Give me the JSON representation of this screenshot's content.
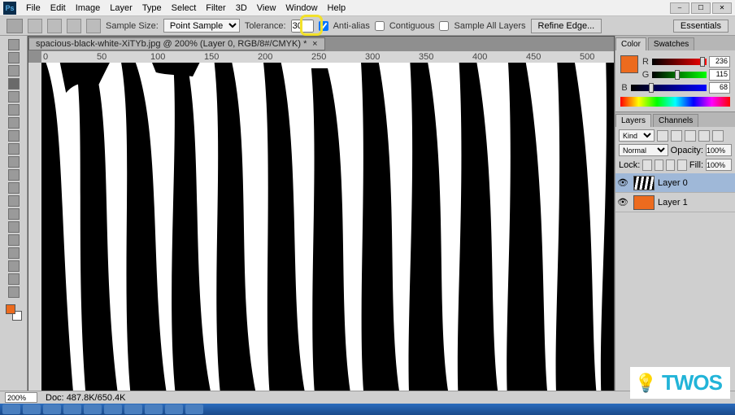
{
  "menu": {
    "items": [
      "File",
      "Edit",
      "Image",
      "Layer",
      "Type",
      "Select",
      "Filter",
      "3D",
      "View",
      "Window",
      "Help"
    ]
  },
  "options_bar": {
    "sample_size_label": "Sample Size:",
    "sample_size_value": "Point Sample",
    "tolerance_label": "Tolerance:",
    "tolerance_value": "30",
    "antialias_label": "Anti-alias",
    "antialias_checked": true,
    "contiguous_label": "Contiguous",
    "contiguous_checked": false,
    "sample_all_label": "Sample All Layers",
    "sample_all_checked": false,
    "refine_edge_label": "Refine Edge...",
    "workspace": "Essentials"
  },
  "document": {
    "tab_title": "spacious-black-white-XiTYb.jpg @ 200% (Layer 0, RGB/8#/CMYK) *",
    "ruler_marks": [
      "0",
      "50",
      "100",
      "150",
      "200",
      "250",
      "300",
      "350",
      "400",
      "450",
      "500"
    ]
  },
  "color_panel": {
    "tab1": "Color",
    "tab2": "Swatches",
    "r_label": "R",
    "g_label": "G",
    "b_label": "B",
    "r_value": "236",
    "g_value": "115",
    "b_value": "68",
    "fg_color": "#ec6b1e"
  },
  "layers_panel": {
    "tab1": "Layers",
    "tab2": "Channels",
    "filter_kind_label": "Kind",
    "blend_mode": "Normal",
    "opacity_label": "Opacity:",
    "opacity_value": "100%",
    "lock_label": "Lock:",
    "fill_label": "Fill:",
    "fill_value": "100%",
    "layers": [
      {
        "name": "Layer 0",
        "thumb": "zebra",
        "active": true
      },
      {
        "name": "Layer 1",
        "thumb": "orange",
        "active": false
      }
    ]
  },
  "status": {
    "zoom": "200%",
    "doc_label": "Doc: ",
    "doc_info": "487.8K/650.4K"
  },
  "watermark": {
    "text": "TWOS"
  }
}
